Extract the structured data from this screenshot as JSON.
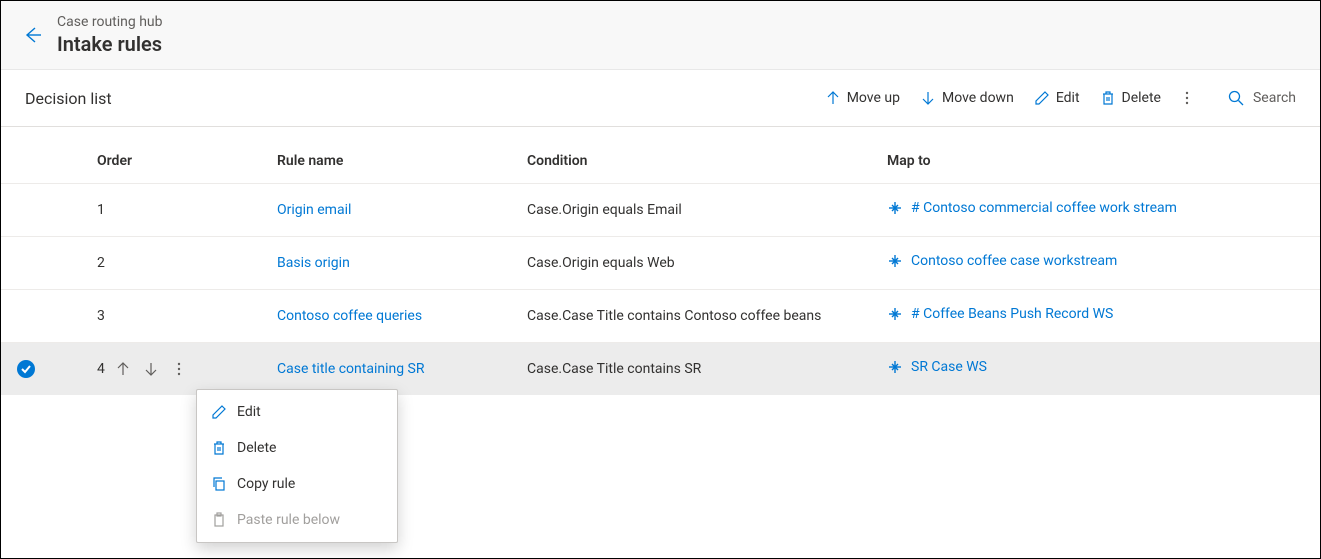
{
  "header": {
    "breadcrumb": "Case routing hub",
    "title": "Intake rules"
  },
  "section_title": "Decision list",
  "commands": {
    "move_up": "Move up",
    "move_down": "Move down",
    "edit": "Edit",
    "delete": "Delete",
    "search": "Search"
  },
  "columns": {
    "order": "Order",
    "rule_name": "Rule name",
    "condition": "Condition",
    "map_to": "Map to"
  },
  "rows": [
    {
      "order": "1",
      "rule_name": "Origin email",
      "condition": "Case.Origin equals Email",
      "map_to": "# Contoso commercial coffee work stream",
      "selected": false
    },
    {
      "order": "2",
      "rule_name": "Basis origin",
      "condition": "Case.Origin equals Web",
      "map_to": "Contoso coffee case workstream",
      "selected": false
    },
    {
      "order": "3",
      "rule_name": "Contoso coffee queries",
      "condition": "Case.Case Title contains Contoso coffee beans",
      "map_to": "# Coffee Beans Push Record WS",
      "selected": false
    },
    {
      "order": "4",
      "rule_name": "Case title containing SR",
      "condition": "Case.Case Title contains SR",
      "map_to": "SR Case WS",
      "selected": true
    }
  ],
  "context_menu": {
    "edit": "Edit",
    "delete": "Delete",
    "copy_rule": "Copy rule",
    "paste_below": "Paste rule below"
  }
}
